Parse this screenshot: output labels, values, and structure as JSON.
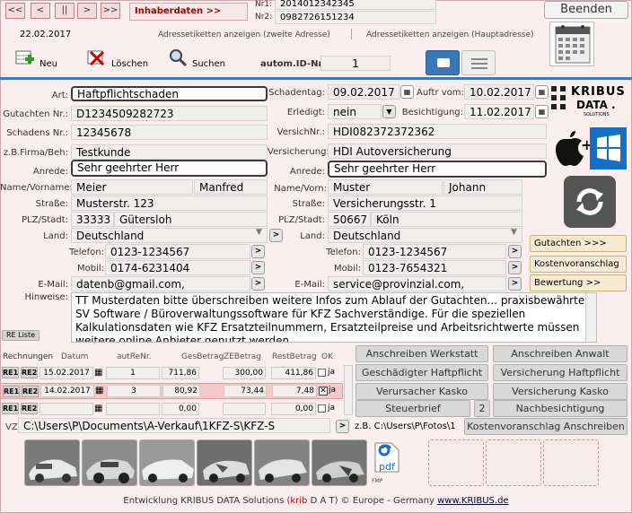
{
  "toolbar": {
    "nav_first": "<<",
    "nav_prev": "<",
    "nav_pause": "||",
    "nav_next": ">",
    "nav_last": ">>",
    "inhaber_label": "Inhaberdaten >>",
    "nr1_label": "Nr1:",
    "nr1_value": "2014012342345",
    "nr2_label": "Nr2:",
    "nr2_value": "0982726151234",
    "beenden_label": "Beenden",
    "date": "22.02.2017",
    "adr_second": "Adressetiketten anzeigen (zweite Adresse)",
    "adr_main": "Adressetiketten anzeigen (Hauptadresse)",
    "neu": "Neu",
    "loeschen": "Löschen",
    "suchen": "Suchen",
    "auto_id_label": "autom.ID-Nr.:",
    "auto_id_value": "1"
  },
  "left": {
    "art_label": "Art:",
    "art": "Haftpflichtschaden",
    "gutachten_label": "Gutachten Nr.:",
    "gutachten": "D1234509282723",
    "schadens_label": "Schadens Nr.:",
    "schadens": "12345678",
    "firma_label": "z.B.Firma/Beh:",
    "firma": "Testkunde",
    "anrede_label": "Anrede:",
    "anrede": "Sehr geehrter Herr",
    "name_label": "Name/Vorname:",
    "name": "Meier",
    "vorname": "Manfred",
    "strasse_label": "Straße:",
    "strasse": "Musterstr. 123",
    "plz_label": "PLZ/Stadt:",
    "plz": "33333",
    "stadt": "Gütersloh",
    "land_label": "Land:",
    "land": "Deutschland",
    "telefon_label": "Telefon:",
    "telefon": "0123-1234567",
    "mobil_label": "Mobil:",
    "mobil": "0174-6231404",
    "email_label": "E-Mail:",
    "email": "datenb@gmail.com,",
    "hinweise_label": "Hinweise:",
    "re_liste": "RE Liste"
  },
  "right": {
    "schadentag_label": "Schadentag:",
    "schadentag": "09.02.2017",
    "auftrvom_label": "Auftr vom:",
    "auftrvom": "10.02.2017",
    "erledigt_label": "Erledigt:",
    "erledigt": "nein",
    "besichtigung_label": "Besichtigung:",
    "besichtigung": "11.02.2017",
    "versich_nr_label": "VersichNr.:",
    "versich_nr": "HDI082372372362",
    "versicherung_label": "Versicherung:",
    "versicherung": "HDI Autoversicherung",
    "anrede_label": "Anrede:",
    "anrede": "Sehr geehrter Herr",
    "name_label": "Name/Vorn:",
    "name": "Muster",
    "vorname": "Johann",
    "strasse_label": "Straße:",
    "strasse": "Versicherungsstr. 1",
    "plz_label": "PLZ/Stadt:",
    "plz": "50667",
    "stadt": "Köln",
    "land_label": "Land:",
    "land": "Deutschland",
    "telefon_label": "Telefon:",
    "telefon": "0123-1234567",
    "mobil_label": "Mobil:",
    "mobil": "0123-7654321",
    "email_label": "E-Mail:",
    "email": "service@provinzial.com,"
  },
  "side": {
    "brand_title": "KRIBUS",
    "brand_sub": "DATA .",
    "brand_tiny": "SOLUTIONS",
    "gutachten_btn": "Gutachten >>>",
    "kostenvoranschlag_btn": "Kostenvoranschlag >>",
    "bewertung_btn": "Bewertung >>"
  },
  "hinweise_text": "TT Musterdaten bitte überschreiben weitere Infos zum Ablauf der Gutachten... praxisbewährte SV Software / Büroverwaltungssoftware für KFZ Sachverständige. Für die speziellen Kalkulationsdaten wie KFZ Ersatzteilnummern, Ersatzteilpreise und Arbeitsrichtwerte müssen weitere online Anbieter genutzt werden.",
  "rechnungen": {
    "headers": [
      "Rechnungen",
      "Datum",
      "autReNr.",
      "GesBetrag",
      "ZEBetrag",
      "RestBetrag",
      "OK"
    ],
    "re1": "RE1",
    "re2": "RE2",
    "ja": "ja",
    "rows": [
      {
        "datum": "15.02.2017",
        "nr": "1",
        "ges": "711,86",
        "ze": "300,00",
        "rest": "411,86",
        "ok": false
      },
      {
        "datum": "14.02.2017",
        "nr": "3",
        "ges": "80,92",
        "ze": "73,44",
        "rest": "7,48",
        "ok": true
      },
      {
        "datum": "",
        "nr": "",
        "ges": "0,00",
        "ze": "",
        "rest": "0,00",
        "ok": false
      }
    ]
  },
  "actions": {
    "anschreiben_werkstatt": "Anschreiben Werkstatt",
    "anschreiben_anwalt": "Anschreiben Anwalt",
    "geschaedigter": "Geschädigter Haftpflicht",
    "versicherung_haft": "Versicherung Haftpflicht",
    "verursacher": "Verursacher Kasko",
    "versicherung_kasko": "Versicherung Kasko",
    "steuerbrief": "Steuerbrief",
    "steuer_count": "2",
    "nachbesichtigung": "Nachbesichtigung",
    "kva_anschreiben": "Kostenvoranschlag Anschreiben"
  },
  "path": {
    "vz_label": "VZ",
    "path": "C:\\Users\\P\\Documents\\A-Verkauf\\1KFZ-S\\KFZ-S",
    "hint": "z.B. C:\\Users\\P\\Fotos\\1",
    "fmp": "FMP",
    "pdf": "pdf"
  },
  "footer": {
    "text1": "Entwicklung KRIBUS DATA Solutions (",
    "krib": "krib",
    "text2": " D A T) © Europe - Germany ",
    "link": "www.KRIBUS.de"
  },
  "colors": {
    "bg": "#fbeeee",
    "highlight_row": "#f6c9c9",
    "orange_btn": "#f7ecd2",
    "windows_blue": "#1570c4"
  }
}
